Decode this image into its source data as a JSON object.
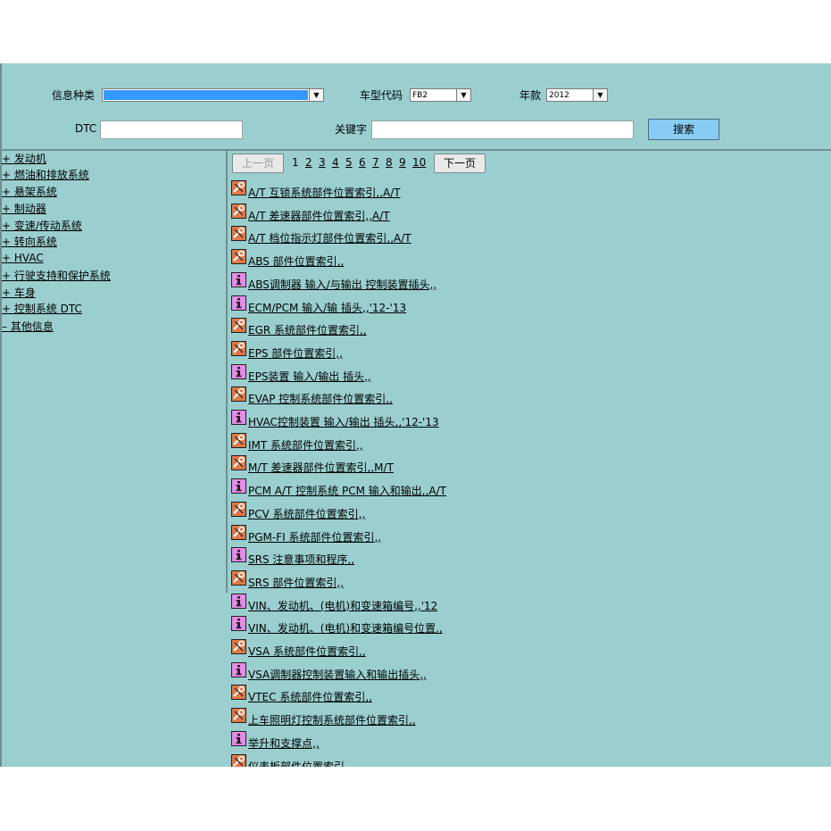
{
  "form": {
    "info_type_label": "信息种类",
    "info_type_value": "",
    "model_code_label": "车型代码",
    "model_code_value": "FB2",
    "year_label": "年款",
    "year_value": "2012",
    "dtc_label": "DTC",
    "dtc_value": "",
    "keyword_label": "关键字",
    "keyword_value": "",
    "search_label": "搜索",
    "dropdown_arrow": "▼"
  },
  "nav": [
    "+ 发动机",
    "+ 燃油和排放系统",
    "+ 悬架系统",
    "+ 制动器",
    "+ 变速/传动系统",
    "+ 转向系统",
    "+ HVAC",
    "+ 行驶支持和保护系统",
    "+ 车身",
    "+ 控制系统 DTC",
    "– 其他信息"
  ],
  "pager": {
    "prev_label": "上一页",
    "next_label": "下一页",
    "current": "1",
    "pages": [
      "2",
      "3",
      "4",
      "5",
      "6",
      "7",
      "8",
      "9",
      "10"
    ]
  },
  "docs": [
    {
      "icon": "wrench-icon",
      "title": "A/T 互锁系统部件位置索引,,A/T"
    },
    {
      "icon": "wrench-icon",
      "title": "A/T 差速器部件位置索引,,A/T"
    },
    {
      "icon": "wrench-icon",
      "title": "A/T 档位指示灯部件位置索引,,A/T"
    },
    {
      "icon": "wrench-icon",
      "title": "ABS 部件位置索引,,"
    },
    {
      "icon": "info-icon",
      "title": "ABS调制器 输入/与输出 控制装置插头,,"
    },
    {
      "icon": "info-icon",
      "title": "ECM/PCM 输入/输 插头,,'12-'13"
    },
    {
      "icon": "wrench-icon",
      "title": "EGR 系统部件位置索引,,"
    },
    {
      "icon": "wrench-icon",
      "title": "EPS 部件位置索引,,"
    },
    {
      "icon": "info-icon",
      "title": "EPS装置 输入/输出 插头,,"
    },
    {
      "icon": "wrench-icon",
      "title": "EVAP 控制系统部件位置索引,,"
    },
    {
      "icon": "info-icon",
      "title": "HVAC控制装置 输入/输出 插头,,'12-'13"
    },
    {
      "icon": "wrench-icon",
      "title": "IMT 系统部件位置索引,,"
    },
    {
      "icon": "wrench-icon",
      "title": "M/T 差速器部件位置索引,,M/T"
    },
    {
      "icon": "info-icon",
      "title": "PCM A/T 控制系统 PCM 输入和输出,,A/T"
    },
    {
      "icon": "wrench-icon",
      "title": "PCV 系统部件位置索引,,"
    },
    {
      "icon": "wrench-icon",
      "title": "PGM-FI 系统部件位置索引,,"
    },
    {
      "icon": "info-icon",
      "title": "SRS 注意事项和程序,,"
    },
    {
      "icon": "wrench-icon",
      "title": "SRS 部件位置索引,,"
    },
    {
      "icon": "info-icon",
      "title": "VIN、发动机、(电机)和变速箱编号,,'12"
    },
    {
      "icon": "info-icon",
      "title": "VIN、发动机、(电机)和变速箱编号位置,,"
    },
    {
      "icon": "wrench-icon",
      "title": "VSA 系统部件位置索引,,"
    },
    {
      "icon": "info-icon",
      "title": "VSA调制器控制装置输入和输出插头,,"
    },
    {
      "icon": "wrench-icon",
      "title": "VTEC 系统部件位置索引,,"
    },
    {
      "icon": "wrench-icon",
      "title": "上车照明灯控制系统部件位置索引,,"
    },
    {
      "icon": "info-icon",
      "title": "举升和支撑点,,"
    },
    {
      "icon": "wrench-icon",
      "title": "仪表板部件位置索引,,"
    }
  ]
}
